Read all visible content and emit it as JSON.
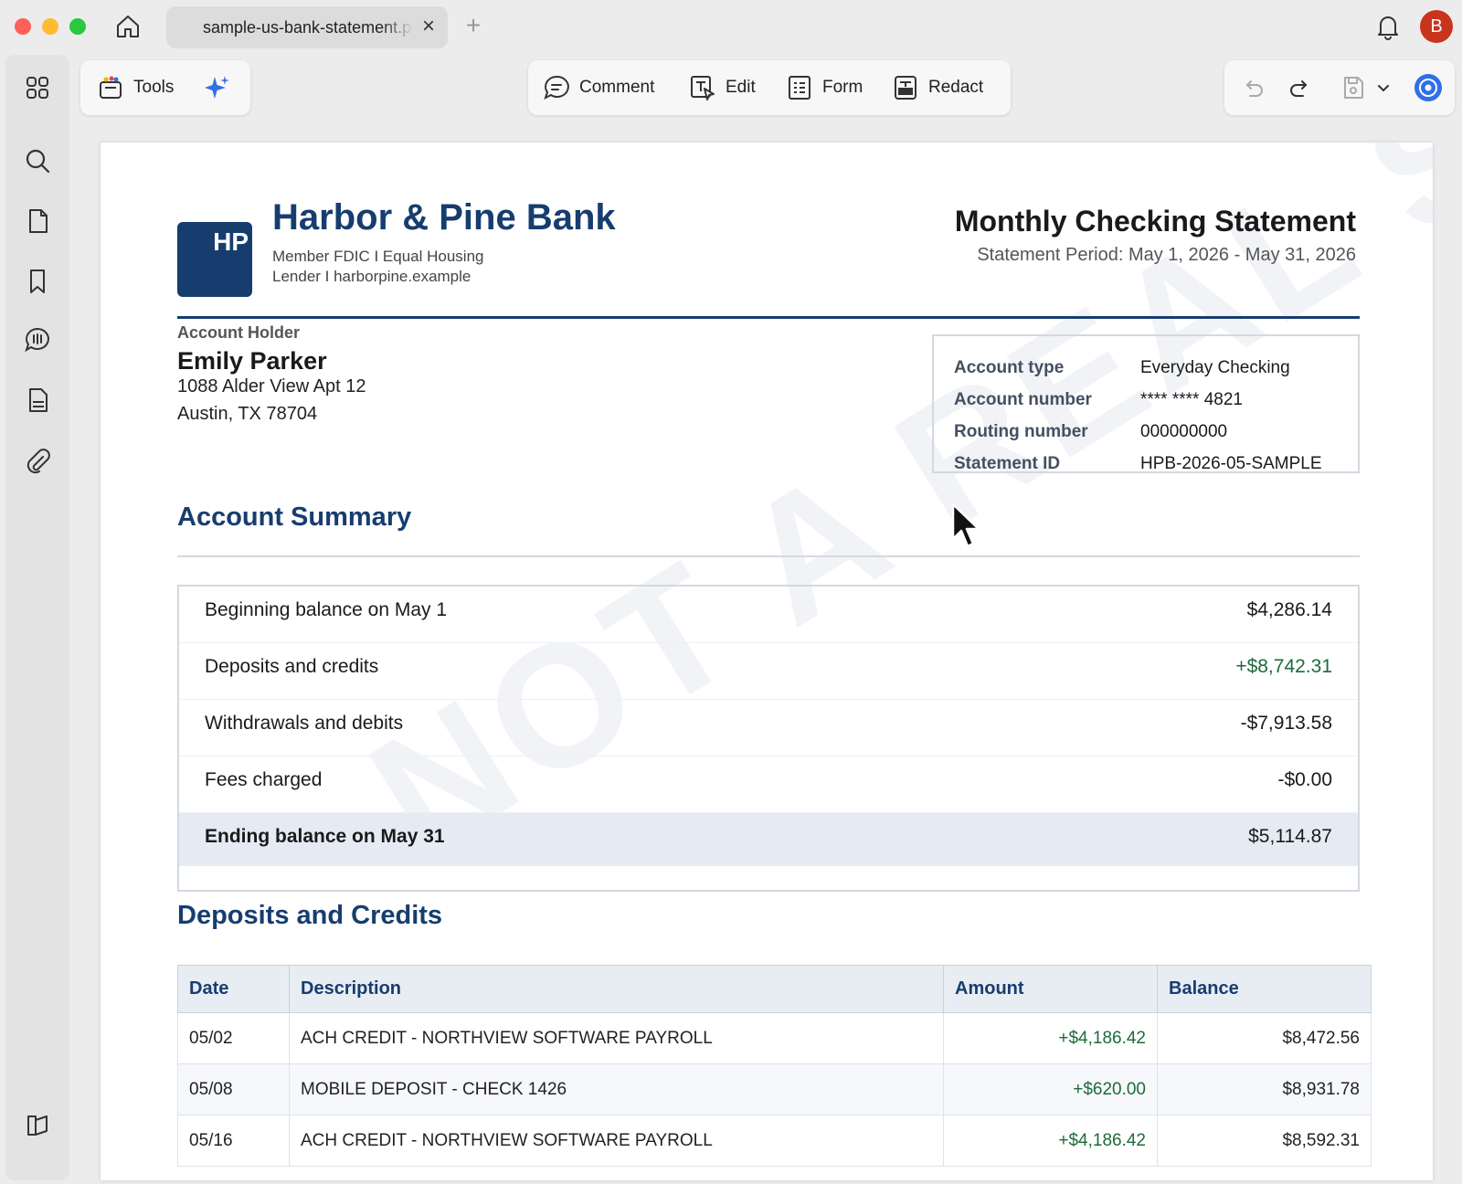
{
  "window": {
    "tab_title": "sample-us-bank-statement.pdf",
    "tab_close": "×",
    "new_tab": "+",
    "avatar_initial": "B"
  },
  "toolbar": {
    "tools_label": "Tools",
    "comment_label": "Comment",
    "edit_label": "Edit",
    "form_label": "Form",
    "redact_label": "Redact"
  },
  "bank": {
    "logo_text": "HP",
    "name": "Harbor & Pine Bank",
    "subtitle": "Member FDIC I Equal Housing Lender I harborpine.example"
  },
  "statement": {
    "title": "Monthly Checking Statement",
    "period": "Statement Period: May 1, 2026 - May 31, 2026"
  },
  "holder": {
    "label": "Account Holder",
    "name": "Emily Parker",
    "address_line1": "1088 Alder View Apt 12",
    "address_line2": "Austin, TX 78704"
  },
  "account_info": [
    {
      "key": "Account type",
      "value": "Everyday Checking"
    },
    {
      "key": "Account number",
      "value": "**** **** 4821"
    },
    {
      "key": "Routing number",
      "value": "000000000"
    },
    {
      "key": "Statement ID",
      "value": "HPB-2026-05-SAMPLE"
    }
  ],
  "summary": {
    "title": "Account Summary",
    "rows": [
      {
        "label": "Beginning balance on May 1",
        "value": "$4,286.14"
      },
      {
        "label": "Deposits and credits",
        "value": "+$8,742.31"
      },
      {
        "label": "Withdrawals and debits",
        "value": "-$7,913.58"
      },
      {
        "label": "Fees charged",
        "value": "-$0.00"
      },
      {
        "label": "Ending balance on May 31",
        "value": "$5,114.87"
      }
    ]
  },
  "deposits": {
    "title": "Deposits and Credits",
    "columns": [
      "Date",
      "Description",
      "Amount",
      "Balance"
    ],
    "rows": [
      {
        "date": "05/02",
        "description": "ACH CREDIT - NORTHVIEW SOFTWARE PAYROLL",
        "amount": "+$4,186.42",
        "balance": "$8,472.56"
      },
      {
        "date": "05/08",
        "description": "MOBILE DEPOSIT - CHECK 1426",
        "amount": "+$620.00",
        "balance": "$8,931.78"
      },
      {
        "date": "05/16",
        "description": "ACH CREDIT - NORTHVIEW SOFTWARE PAYROLL",
        "amount": "+$4,186.42",
        "balance": "$8,592.31"
      }
    ]
  },
  "watermark": "NOT A REAL STATEMENT",
  "colors": {
    "brand": "#173d6f",
    "positive": "#1d6b3a",
    "accent_ai": "#2f6fe8"
  },
  "icons": [
    "home-icon",
    "bell-icon",
    "apps-grid-icon",
    "search-icon",
    "page-icon",
    "bookmark-icon",
    "comments-icon",
    "layers-icon",
    "paperclip-icon",
    "sidebar-toggle-icon",
    "tools-icon",
    "sparkle-icon",
    "comment-icon",
    "edit-text-icon",
    "form-icon",
    "redact-icon",
    "undo-icon",
    "redo-icon",
    "save-icon",
    "chevron-down-icon",
    "assistant-icon"
  ]
}
